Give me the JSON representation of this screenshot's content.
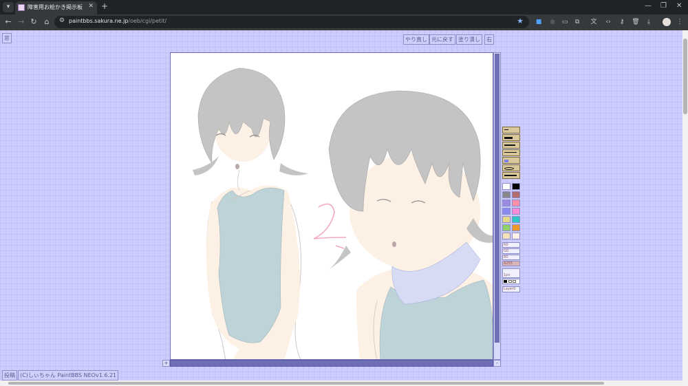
{
  "browser": {
    "tab_title": "障害用お絵かき掲示板",
    "url_host": "paintbbs.sakura.ne.jp",
    "url_path": "/oeb/cgi/petit/"
  },
  "page": {
    "window_button": "窓",
    "top_buttons": [
      "やり直し",
      "元に戻す",
      "塗り潰し",
      "右"
    ],
    "post_button": "投稿",
    "credit": "(C)しぃちゃん PaintBBS NEOv1.6.21"
  },
  "palette": {
    "colors": [
      "#ffffff",
      "#000000",
      "#888888",
      "#b36b6b",
      "#9a8be0",
      "#ff8ea9",
      "#8a8af0",
      "#ff8ad8",
      "#e8d98a",
      "#2ec6c6",
      "#8fd16b",
      "#f09a2a",
      "#f3e2b8",
      "#fff1e8"
    ],
    "sliders": [
      "R0",
      "G0",
      "B0",
      "A255"
    ],
    "size_label": "1px",
    "layer_label": "Layer0"
  }
}
